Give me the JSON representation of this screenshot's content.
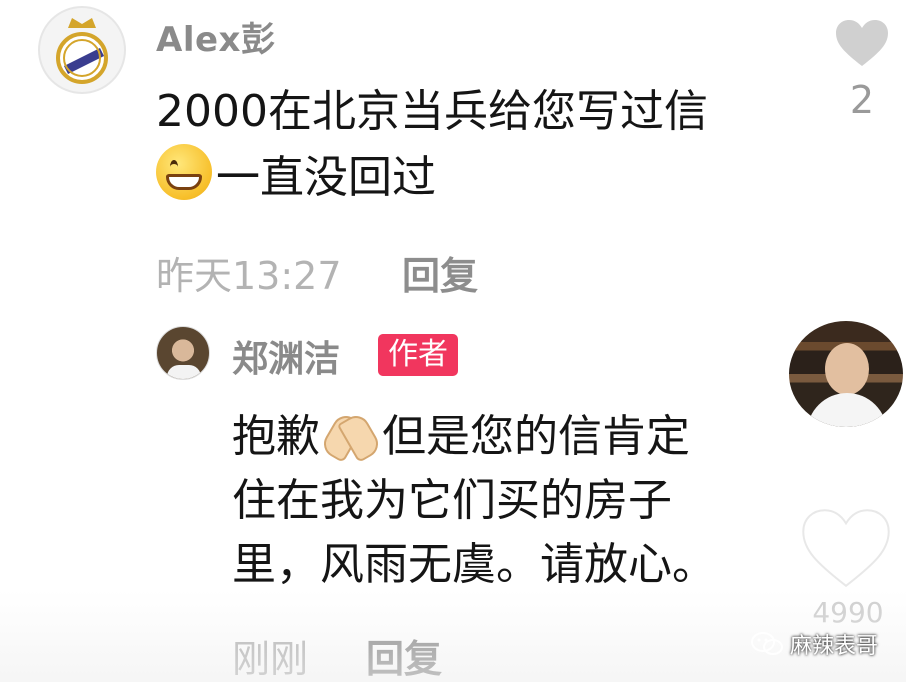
{
  "main_comment": {
    "username": "Alex彭",
    "avatar": "real-madrid-crest-icon",
    "text_lines": [
      "2000在北京当兵给您写过信",
      "一直没回过"
    ],
    "emoji": "grinning-face-icon",
    "time": "昨天13:27",
    "reply_label": "回复",
    "like_icon": "heart-icon",
    "like_count": "2"
  },
  "reply": {
    "username": "郑渊洁",
    "badge": "作者",
    "text_lines": [
      "抱歉",
      "但是您的信肯定",
      "住在我为它们买的房子",
      "里，风雨无虞。请放心。"
    ],
    "emoji": "folded-hands-icon",
    "time": "刚刚",
    "reply_label": "回复"
  },
  "side_panel": {
    "like_count": "4990",
    "like_icon": "heart-icon"
  },
  "watermark": {
    "text": "麻辣表哥",
    "icon": "wechat-icon"
  },
  "colors": {
    "badge": "#f1365e",
    "username": "#8a8a8a",
    "meta": "#b3b3b3"
  }
}
